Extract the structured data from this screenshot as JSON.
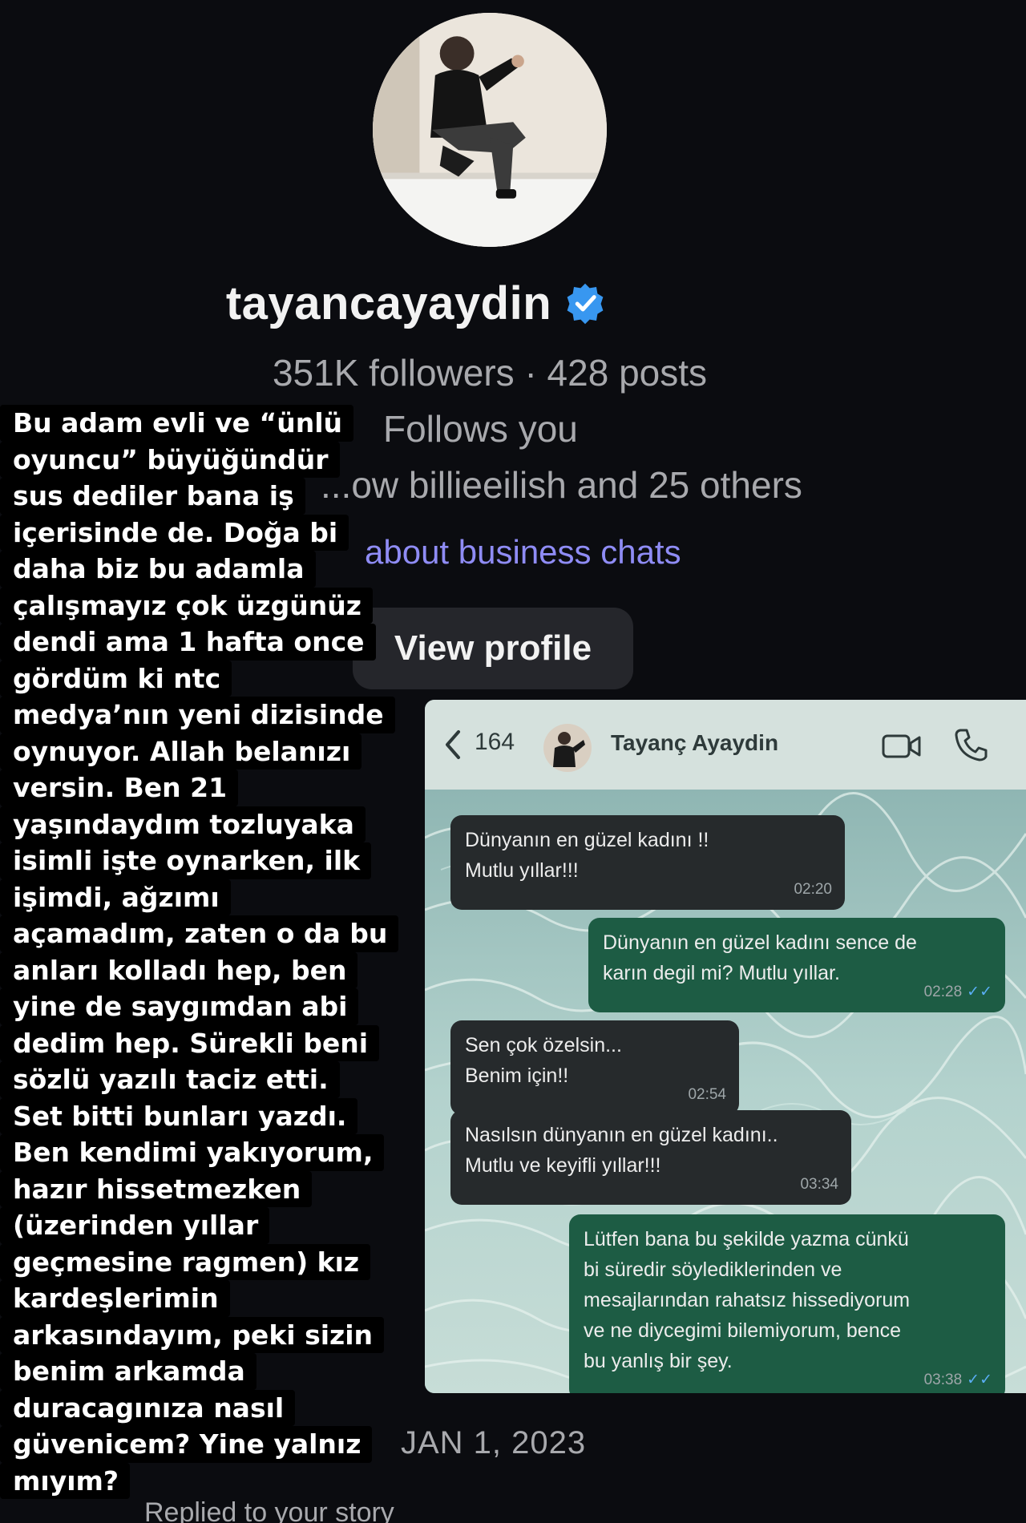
{
  "profile": {
    "username": "tayancayaydin",
    "stats": "351K followers · 428 posts",
    "follows_you": "Follows you",
    "followed_by": "...ow billieeilish and 25 others",
    "business_link": "about business chats",
    "view_profile_label": "View profile"
  },
  "thread": {
    "date": "JAN 1, 2023",
    "replied_label": "Replied to your story"
  },
  "overlay_text": [
    "Bu adam evli ve “ünlü",
    "oyuncu” büyüğündür",
    "sus dediler bana iş",
    "içerisinde de. Doğa bi",
    "daha biz bu adamla",
    "çalışmayız çok üzgünüz",
    "dendi ama 1 hafta once",
    "gördüm ki ntc",
    "medya’nın yeni dizisinde",
    "oynuyor. Allah belanızı",
    "versin. Ben 21",
    "yaşındaydım tozluyaka",
    "isimli işte oynarken, ilk",
    "işimdi, ağzımı",
    "açamadım, zaten o da bu",
    "anları kolladı hep, ben",
    "yine de saygımdan abi",
    "dedim hep. Sürekli beni",
    "sözlü yazılı taciz etti.",
    "Set bitti bunları yazdı.",
    "Ben kendimi yakıyorum,",
    "hazır hissetmezken",
    "(üzerinden yıllar",
    "geçmesine ragmen) kız",
    "kardeşlerimin",
    "arkasındayım, peki sizin",
    "benim arkamda",
    "duracagınıza nasıl",
    "güvenicem? Yine yalnız",
    "mıyım?"
  ],
  "whatsapp": {
    "back_count": "164",
    "contact_name": "Tayanç Ayaydin",
    "messages": [
      {
        "direction": "in",
        "lines": [
          "Dünyanın en güzel kadını !!",
          "Mutlu yıllar!!!"
        ],
        "time": "02:20",
        "read": false
      },
      {
        "direction": "out",
        "lines": [
          "Dünyanın en güzel kadını sence de",
          "karın degil mi? Mutlu yıllar."
        ],
        "time": "02:28",
        "read": true
      },
      {
        "direction": "in",
        "lines": [
          "Sen çok özelsin...",
          "Benim için!!"
        ],
        "time": "02:54",
        "read": false
      },
      {
        "direction": "in",
        "lines": [
          "Nasılsın dünyanın en güzel kadını..",
          "Mutlu ve keyifli yıllar!!!"
        ],
        "time": "03:34",
        "read": false
      },
      {
        "direction": "out",
        "lines": [
          "Lütfen bana bu şekilde yazma cünkü",
          "bi süredir söylediklerinden ve",
          "mesajlarından rahatsız hissediyorum",
          "ve ne diycegimi bilemiyorum, bence",
          "bu yanlış bir şey."
        ],
        "time": "03:38",
        "read": true
      }
    ],
    "colors": {
      "incoming_bubble": "#262a2c",
      "outgoing_bubble": "#1d5c44",
      "read_ticks": "#5aaef5"
    }
  },
  "icons": [
    "verified-badge-icon",
    "back-chevron-icon",
    "video-call-icon",
    "phone-call-icon",
    "read-ticks-icon"
  ],
  "colors": {
    "background": "#0b0c10",
    "muted_text": "#a8a9ad",
    "link": "#8f8cf5",
    "verified_badge": "#3897f0"
  }
}
